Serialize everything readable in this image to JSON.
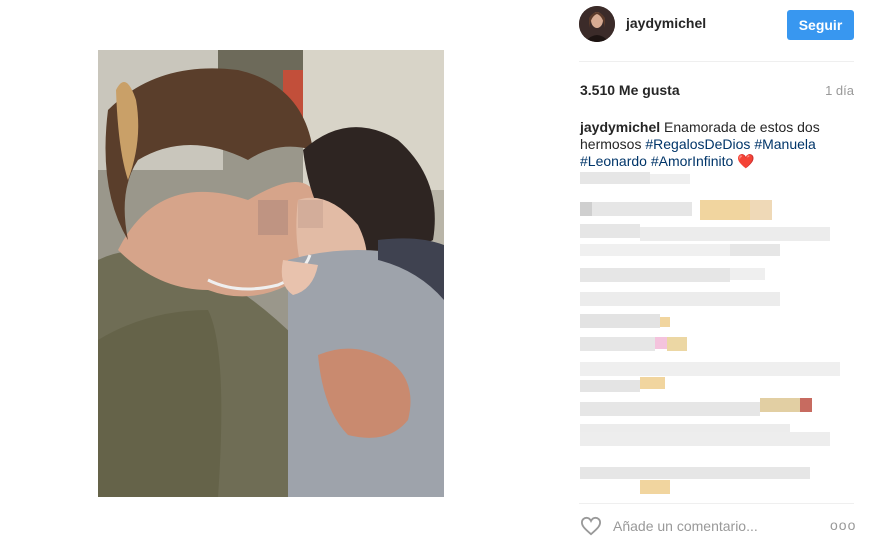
{
  "post": {
    "username": "jaydymichel",
    "follow_label": "Seguir",
    "likes": "3.510 Me gusta",
    "time_ago": "1 día",
    "caption": {
      "user": "jaydymichel",
      "text": "Enamorada de estos dos hermosos",
      "hashtags": [
        "#RegalosDeDios",
        "#Manuela",
        "#Leonardo",
        "#AmorInfinito"
      ],
      "emoji": "❤️"
    },
    "comment_placeholder": "Añade un comentario...",
    "more_label": "ooo"
  },
  "icons": {
    "like": "heart-outline-icon",
    "more": "more-options-icon"
  },
  "colors": {
    "accent": "#3897f0",
    "hashtag": "#003569",
    "heart": "#e0245e",
    "muted": "#999999"
  }
}
